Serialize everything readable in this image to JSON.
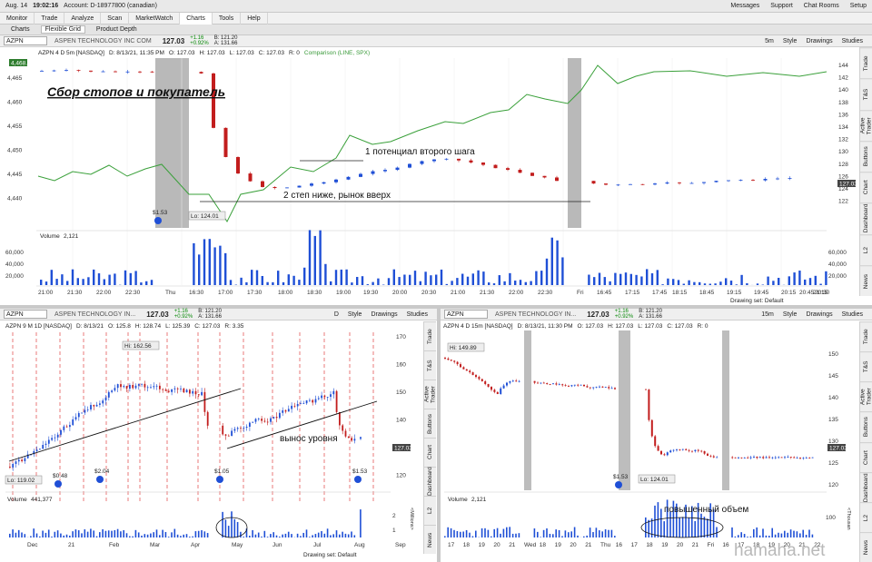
{
  "status_bar": {
    "date": "Aug. 14",
    "time": "19:02:16",
    "account": "Account: D-18977800 (canadian)",
    "messages": "Messages",
    "support": "Support",
    "chat": "Chat Rooms",
    "setup": "Setup"
  },
  "menu": [
    "Monitor",
    "Trade",
    "Analyze",
    "Scan",
    "MarketWatch",
    "Charts",
    "Tools",
    "Help"
  ],
  "active_menu": "Charts",
  "subtabs": [
    "Charts",
    "Flexible Grid",
    "Product Depth"
  ],
  "active_subtab": "Flexible Grid",
  "sidebar_tabs": [
    "Trade",
    "T&S",
    "Active Trader",
    "Buttons",
    "Chart",
    "Dashboard",
    "L2",
    "News"
  ],
  "toolbar": {
    "style": "Style",
    "drawings": "Drawings",
    "studies": "Studies",
    "drawing_set": "Drawing set: Default"
  },
  "top_chart": {
    "symbol": "AZPN",
    "name": "ASPEN TECHNOLOGY INC COM",
    "price": "127.03",
    "change": "+1.16",
    "change_pct": "+0.92%",
    "bid": "B: 121.20",
    "ask": "A: 131.66",
    "period": "5m",
    "info": [
      "AZPN 4 D 5m [NASDAQ]",
      "D: 8/13/21, 11:35 PM",
      "O: 127.03",
      "H: 127.03",
      "L: 127.03",
      "C: 127.03",
      "R: 0"
    ],
    "comparison": "Comparison (LINE, SPX)",
    "left_marker": "4,468.01",
    "low_label": "Lo: 124.01",
    "div_label": "$1.53",
    "volume_label": "Volume",
    "volume_value": "2,121",
    "annotation_title": "Сбор стопов и покупатель",
    "annotation_1": "1 потенциал второго шага",
    "annotation_2": "2 степ ниже, рынок вверх",
    "price_ticks": [
      "144",
      "142",
      "140",
      "138",
      "136",
      "134",
      "132",
      "130",
      "128",
      "126",
      "124",
      "122"
    ],
    "spx_ticks": [
      "4,465",
      "4,460",
      "4,455",
      "4,450",
      "4,445",
      "4,440"
    ],
    "volume_ticks": [
      "60,000",
      "40,000",
      "20,000"
    ],
    "time_ticks": [
      "21:00",
      "21:30",
      "22:00",
      "22:30",
      "Thu",
      "16:30",
      "17:00",
      "17:30",
      "18:00",
      "18:30",
      "19:00",
      "19:30",
      "20:00",
      "20:30",
      "21:00",
      "21:30",
      "22:00",
      "22:30",
      "Fri",
      "16:45",
      "17:15",
      "17:45",
      "18:15",
      "18:45",
      "19:15",
      "19:45",
      "20:15",
      "20:45",
      "21:15",
      "21:45",
      "22:15",
      "22:45",
      "20:30"
    ],
    "last_badge": "127.03"
  },
  "bl_chart": {
    "symbol": "AZPN",
    "name": "ASPEN TECHNOLOGY IN...",
    "price": "127.03",
    "change": "+1.16",
    "change_pct": "+0.92%",
    "bid": "B: 121.20",
    "ask": "A: 131.66",
    "period": "D",
    "info": [
      "AZPN 9 M 1D [NASDAQ]",
      "D: 8/13/21",
      "O: 125.8",
      "H: 128.74",
      "L: 125.39",
      "C: 127.03",
      "R: 3.35"
    ],
    "hi_label": "Hi: 162.56",
    "lo_label": "Lo: 119.02",
    "annotation": "вынос уровня",
    "div_labels": [
      "$0.48",
      "$2.04",
      "$1.05",
      "$1.53"
    ],
    "volume_label": "Volume",
    "volume_value": "441,377",
    "volume_unit": "<Millions>",
    "price_ticks": [
      "170",
      "160",
      "150",
      "140",
      "130",
      "120"
    ],
    "volume_ticks": [
      "2",
      "1"
    ],
    "time_ticks": [
      "Dec",
      "21",
      "Feb",
      "Mar",
      "Apr",
      "May",
      "Jun",
      "Jul",
      "Aug",
      "Sep"
    ],
    "last_badge": "127.03"
  },
  "br_chart": {
    "symbol": "AZPN",
    "name": "ASPEN TECHNOLOGY IN...",
    "price": "127.03",
    "change": "+1.16",
    "change_pct": "+0.92%",
    "bid": "B: 121.20",
    "ask": "A: 131.66",
    "period": "15m",
    "info": [
      "AZPN 4 D 15m [NASDAQ]",
      "D: 8/13/21, 11:30 PM",
      "O: 127.03",
      "H: 127.03",
      "L: 127.03",
      "C: 127.03",
      "R: 0"
    ],
    "hi_label": "Hi: 149.89",
    "lo_label": "Lo: 124.01",
    "div_label": "$1.53",
    "annotation": "повышенный объем",
    "volume_label": "Volume",
    "volume_value": "2,121",
    "volume_unit": "<Thousan",
    "price_ticks": [
      "150",
      "145",
      "140",
      "135",
      "130",
      "125",
      "120"
    ],
    "volume_ticks": [
      "100"
    ],
    "time_ticks": [
      "17",
      "18",
      "19",
      "20",
      "21",
      "Wed",
      "18",
      "19",
      "20",
      "21",
      "Thu",
      "16",
      "17",
      "18",
      "19",
      "20",
      "21",
      "Fri",
      "16",
      "17",
      "18",
      "19",
      "20",
      "21",
      "22"
    ],
    "last_badge": "127.03"
  },
  "watermark": "hamaha.net"
}
